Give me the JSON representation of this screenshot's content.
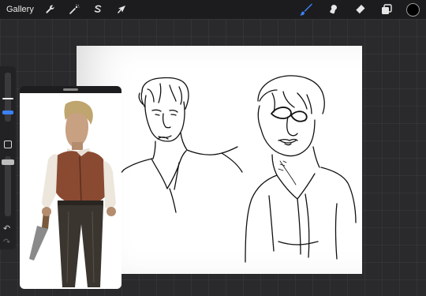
{
  "topbar": {
    "gallery_label": "Gallery",
    "left_tools": [
      {
        "icon": "wrench-icon",
        "name": "actions"
      },
      {
        "icon": "magic-wand-icon",
        "name": "adjustments"
      },
      {
        "icon": "selection-icon",
        "name": "selection"
      },
      {
        "icon": "arrow-cursor-icon",
        "name": "transform"
      }
    ],
    "right_tools": [
      {
        "icon": "brush-icon",
        "name": "brush",
        "active": true
      },
      {
        "icon": "smudge-icon",
        "name": "smudge"
      },
      {
        "icon": "eraser-icon",
        "name": "eraser"
      },
      {
        "icon": "layers-icon",
        "name": "layers"
      }
    ],
    "current_color": "#000000"
  },
  "sidebar": {
    "brush_size_slider": "brush-size",
    "opacity_slider": "opacity",
    "modify_button": "square-icon",
    "undo_icon": "undo-arrow-icon",
    "redo_icon": "redo-arrow-icon"
  },
  "colors": {
    "accent": "#3b82f6",
    "topbar_bg": "#1c1c1e",
    "workspace_bg": "#2a2a2c",
    "canvas_bg": "#ffffff"
  },
  "reference": {
    "description_icon": "reference-image"
  }
}
